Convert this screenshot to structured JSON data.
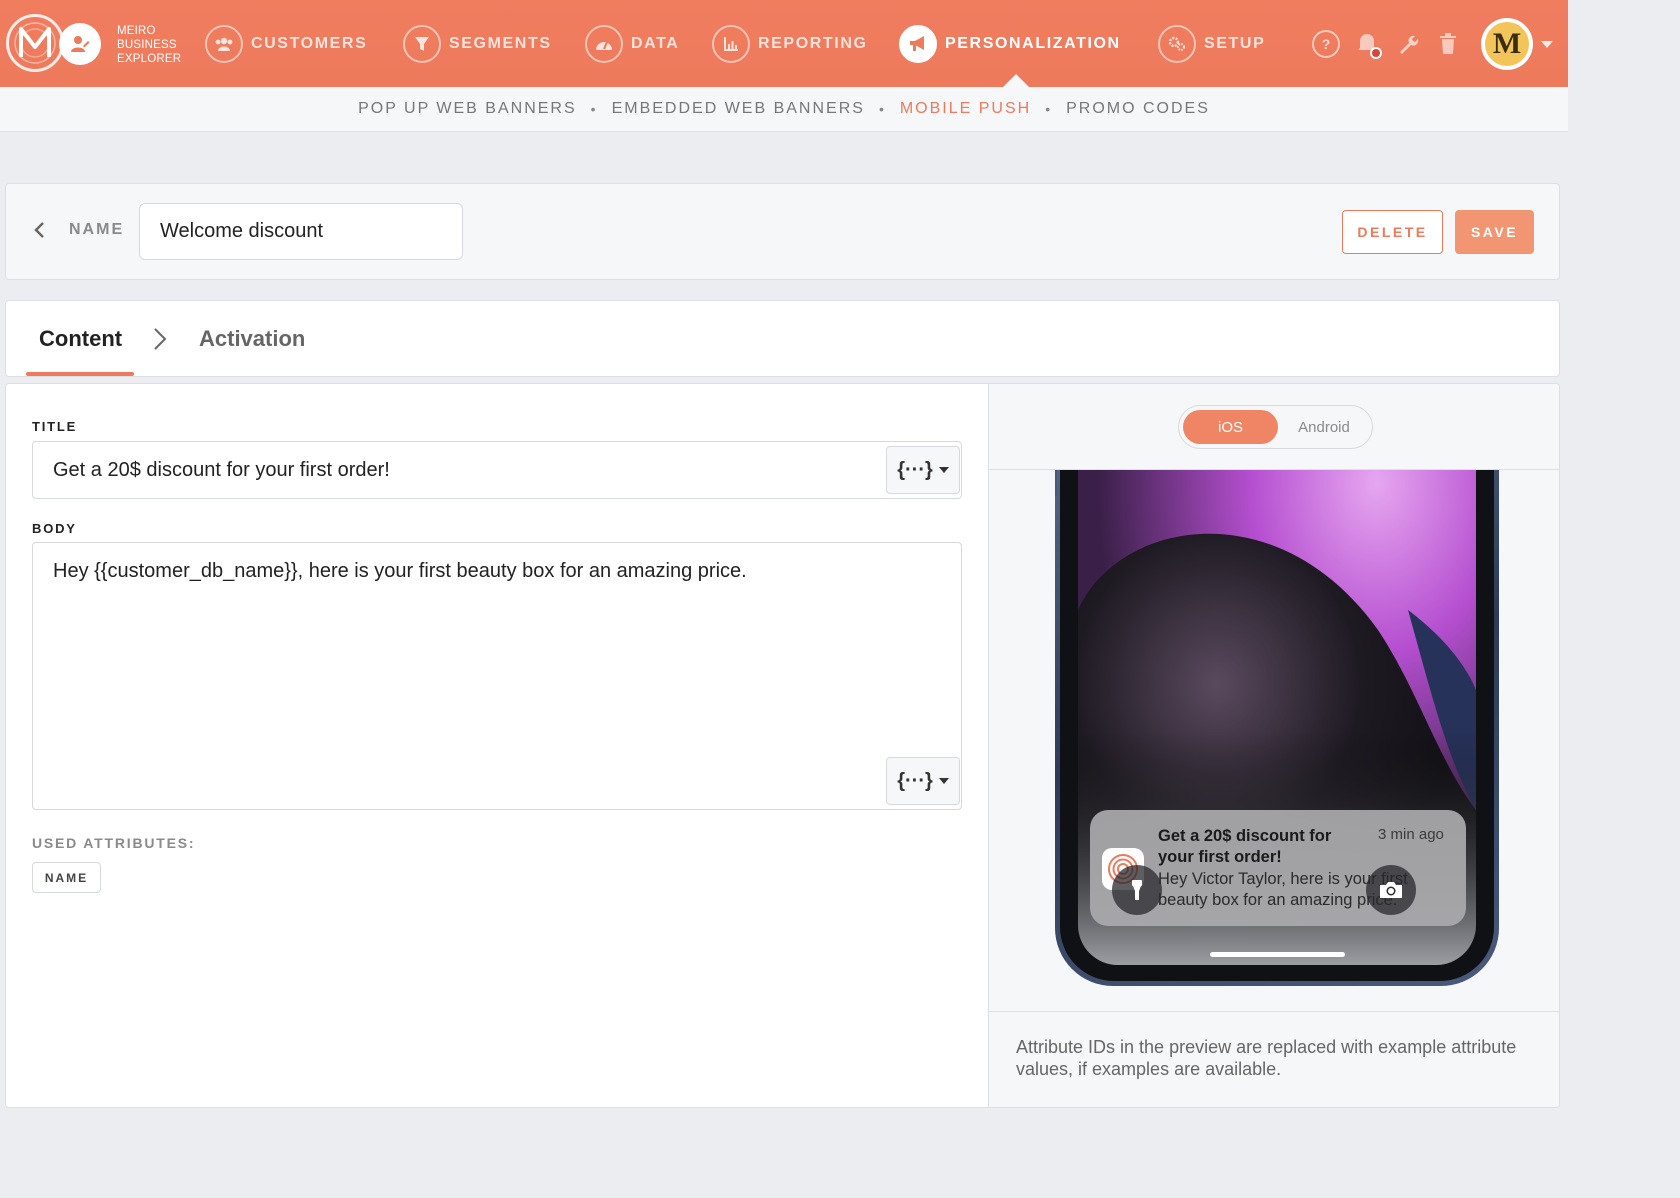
{
  "app": {
    "brand": [
      "MEIRO",
      "BUSINESS",
      "EXPLORER"
    ],
    "brand_line1": "MEIRO",
    "brand_line2": "BUSINESS",
    "brand_line3": "EXPLORER",
    "accent_color": "#ec7a5c"
  },
  "topnav": {
    "items": [
      {
        "label": "CUSTOMERS",
        "icon": "users-icon"
      },
      {
        "label": "SEGMENTS",
        "icon": "funnel-icon"
      },
      {
        "label": "DATA",
        "icon": "gauge-icon"
      },
      {
        "label": "REPORTING",
        "icon": "bar-chart-icon"
      },
      {
        "label": "PERSONALIZATION",
        "icon": "megaphone-icon",
        "active": true
      },
      {
        "label": "SETUP",
        "icon": "gears-icon"
      }
    ],
    "utilities": [
      "help-icon",
      "bell-icon",
      "wrench-icon",
      "trash-icon"
    ],
    "avatar_letter": "M"
  },
  "subnav": {
    "items": [
      {
        "label": "POP UP WEB BANNERS"
      },
      {
        "label": "EMBEDDED WEB BANNERS"
      },
      {
        "label": "MOBILE PUSH",
        "active": true
      },
      {
        "label": "PROMO CODES"
      }
    ],
    "separator": "•"
  },
  "name_bar": {
    "label": "NAME",
    "value": "Welcome discount",
    "delete_label": "DELETE",
    "save_label": "SAVE"
  },
  "tabs": {
    "content": "Content",
    "activation": "Activation",
    "active": "Content"
  },
  "form": {
    "title_label": "TITLE",
    "title_value": "Get a 20$ discount for your first order!",
    "body_label": "BODY",
    "body_value": "Hey {{customer_db_name}}, here is your first beauty box for an amazing price.",
    "attr_button_glyph": "{···}",
    "used_attributes_label": "USED ATTRIBUTES:",
    "used_attributes": [
      "NAME"
    ]
  },
  "preview": {
    "os_options": [
      "iOS",
      "Android"
    ],
    "os_ios": "iOS",
    "os_android": "Android",
    "selected_os": "iOS",
    "notification": {
      "title": "Get a 20$ discount for your first order!",
      "time": "3 min ago",
      "body": "Hey Victor Taylor, here is your first beauty box for an amazing price."
    },
    "note": "Attribute IDs in the preview are replaced with example attribute values, if examples are available."
  }
}
